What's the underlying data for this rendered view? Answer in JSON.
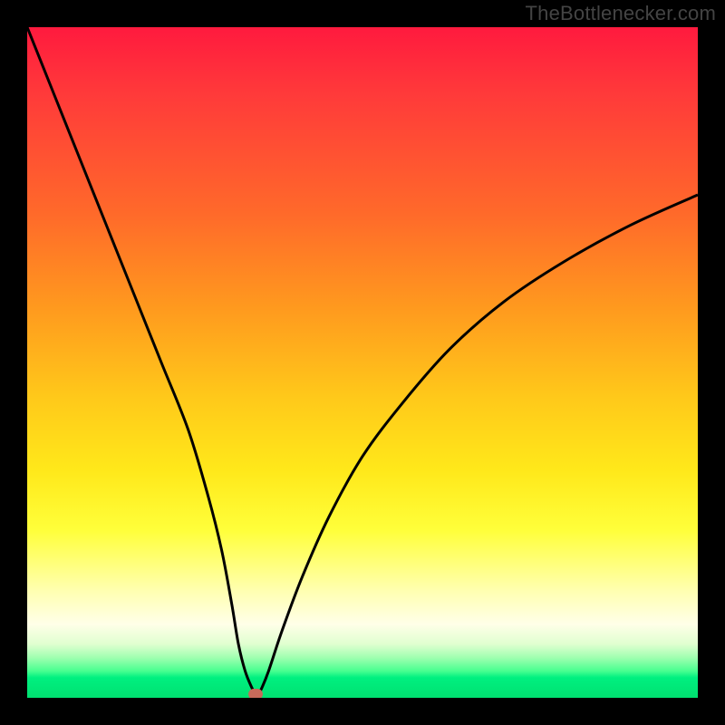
{
  "watermark": "TheBottlenecker.com",
  "chart_data": {
    "type": "line",
    "title": "",
    "xlabel": "",
    "ylabel": "",
    "xlim": [
      0,
      100
    ],
    "ylim": [
      0,
      100
    ],
    "series": [
      {
        "name": "bottleneck-curve",
        "x": [
          0,
          4,
          8,
          12,
          16,
          20,
          24,
          27,
          29,
          30.5,
          31.5,
          32.5,
          33.5,
          34,
          34.5,
          35,
          36,
          38,
          41,
          45,
          50,
          56,
          63,
          71,
          80,
          90,
          100
        ],
        "y": [
          100,
          90,
          80,
          70,
          60,
          50,
          40,
          30,
          22,
          14,
          8,
          4,
          1.5,
          0.6,
          0.6,
          1.5,
          4,
          10,
          18,
          27,
          36,
          44,
          52,
          59,
          65,
          70.5,
          75
        ]
      }
    ],
    "min_point": {
      "x": 34,
      "y": 0.6
    },
    "grid": false,
    "legend": false,
    "background": {
      "type": "vertical-gradient",
      "stops": [
        {
          "pos": 0.0,
          "color": "#ff1a3e"
        },
        {
          "pos": 0.5,
          "color": "#ffc81a"
        },
        {
          "pos": 0.8,
          "color": "#ffff80"
        },
        {
          "pos": 0.95,
          "color": "#80ffb0"
        },
        {
          "pos": 1.0,
          "color": "#00e070"
        }
      ]
    }
  },
  "colors": {
    "curve": "#000000",
    "frame": "#000000",
    "min_dot": "#c66a5a"
  }
}
